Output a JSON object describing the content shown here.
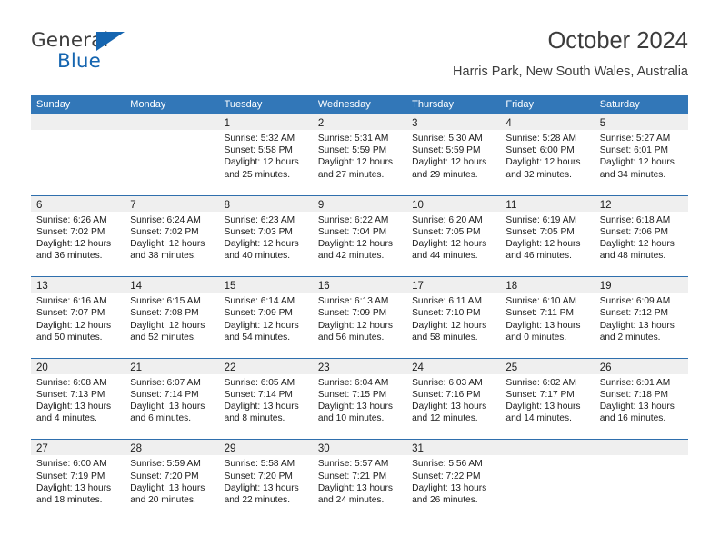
{
  "logo": {
    "word1": "General",
    "word2": "Blue",
    "triangle_color": "#1565b0"
  },
  "header": {
    "title": "October 2024",
    "location": "Harris Park, New South Wales, Australia"
  },
  "theme": {
    "header_blue": "#3277b8",
    "row_rule_blue": "#2f6fad",
    "date_band_gray": "#efefef"
  },
  "weekday_headers": [
    "Sunday",
    "Monday",
    "Tuesday",
    "Wednesday",
    "Thursday",
    "Friday",
    "Saturday"
  ],
  "weeks": [
    [
      {
        "day": "",
        "sunrise": "",
        "sunset": "",
        "daylight1": "",
        "daylight2": ""
      },
      {
        "day": "",
        "sunrise": "",
        "sunset": "",
        "daylight1": "",
        "daylight2": ""
      },
      {
        "day": "1",
        "sunrise": "Sunrise: 5:32 AM",
        "sunset": "Sunset: 5:58 PM",
        "daylight1": "Daylight: 12 hours",
        "daylight2": "and 25 minutes."
      },
      {
        "day": "2",
        "sunrise": "Sunrise: 5:31 AM",
        "sunset": "Sunset: 5:59 PM",
        "daylight1": "Daylight: 12 hours",
        "daylight2": "and 27 minutes."
      },
      {
        "day": "3",
        "sunrise": "Sunrise: 5:30 AM",
        "sunset": "Sunset: 5:59 PM",
        "daylight1": "Daylight: 12 hours",
        "daylight2": "and 29 minutes."
      },
      {
        "day": "4",
        "sunrise": "Sunrise: 5:28 AM",
        "sunset": "Sunset: 6:00 PM",
        "daylight1": "Daylight: 12 hours",
        "daylight2": "and 32 minutes."
      },
      {
        "day": "5",
        "sunrise": "Sunrise: 5:27 AM",
        "sunset": "Sunset: 6:01 PM",
        "daylight1": "Daylight: 12 hours",
        "daylight2": "and 34 minutes."
      }
    ],
    [
      {
        "day": "6",
        "sunrise": "Sunrise: 6:26 AM",
        "sunset": "Sunset: 7:02 PM",
        "daylight1": "Daylight: 12 hours",
        "daylight2": "and 36 minutes."
      },
      {
        "day": "7",
        "sunrise": "Sunrise: 6:24 AM",
        "sunset": "Sunset: 7:02 PM",
        "daylight1": "Daylight: 12 hours",
        "daylight2": "and 38 minutes."
      },
      {
        "day": "8",
        "sunrise": "Sunrise: 6:23 AM",
        "sunset": "Sunset: 7:03 PM",
        "daylight1": "Daylight: 12 hours",
        "daylight2": "and 40 minutes."
      },
      {
        "day": "9",
        "sunrise": "Sunrise: 6:22 AM",
        "sunset": "Sunset: 7:04 PM",
        "daylight1": "Daylight: 12 hours",
        "daylight2": "and 42 minutes."
      },
      {
        "day": "10",
        "sunrise": "Sunrise: 6:20 AM",
        "sunset": "Sunset: 7:05 PM",
        "daylight1": "Daylight: 12 hours",
        "daylight2": "and 44 minutes."
      },
      {
        "day": "11",
        "sunrise": "Sunrise: 6:19 AM",
        "sunset": "Sunset: 7:05 PM",
        "daylight1": "Daylight: 12 hours",
        "daylight2": "and 46 minutes."
      },
      {
        "day": "12",
        "sunrise": "Sunrise: 6:18 AM",
        "sunset": "Sunset: 7:06 PM",
        "daylight1": "Daylight: 12 hours",
        "daylight2": "and 48 minutes."
      }
    ],
    [
      {
        "day": "13",
        "sunrise": "Sunrise: 6:16 AM",
        "sunset": "Sunset: 7:07 PM",
        "daylight1": "Daylight: 12 hours",
        "daylight2": "and 50 minutes."
      },
      {
        "day": "14",
        "sunrise": "Sunrise: 6:15 AM",
        "sunset": "Sunset: 7:08 PM",
        "daylight1": "Daylight: 12 hours",
        "daylight2": "and 52 minutes."
      },
      {
        "day": "15",
        "sunrise": "Sunrise: 6:14 AM",
        "sunset": "Sunset: 7:09 PM",
        "daylight1": "Daylight: 12 hours",
        "daylight2": "and 54 minutes."
      },
      {
        "day": "16",
        "sunrise": "Sunrise: 6:13 AM",
        "sunset": "Sunset: 7:09 PM",
        "daylight1": "Daylight: 12 hours",
        "daylight2": "and 56 minutes."
      },
      {
        "day": "17",
        "sunrise": "Sunrise: 6:11 AM",
        "sunset": "Sunset: 7:10 PM",
        "daylight1": "Daylight: 12 hours",
        "daylight2": "and 58 minutes."
      },
      {
        "day": "18",
        "sunrise": "Sunrise: 6:10 AM",
        "sunset": "Sunset: 7:11 PM",
        "daylight1": "Daylight: 13 hours",
        "daylight2": "and 0 minutes."
      },
      {
        "day": "19",
        "sunrise": "Sunrise: 6:09 AM",
        "sunset": "Sunset: 7:12 PM",
        "daylight1": "Daylight: 13 hours",
        "daylight2": "and 2 minutes."
      }
    ],
    [
      {
        "day": "20",
        "sunrise": "Sunrise: 6:08 AM",
        "sunset": "Sunset: 7:13 PM",
        "daylight1": "Daylight: 13 hours",
        "daylight2": "and 4 minutes."
      },
      {
        "day": "21",
        "sunrise": "Sunrise: 6:07 AM",
        "sunset": "Sunset: 7:14 PM",
        "daylight1": "Daylight: 13 hours",
        "daylight2": "and 6 minutes."
      },
      {
        "day": "22",
        "sunrise": "Sunrise: 6:05 AM",
        "sunset": "Sunset: 7:14 PM",
        "daylight1": "Daylight: 13 hours",
        "daylight2": "and 8 minutes."
      },
      {
        "day": "23",
        "sunrise": "Sunrise: 6:04 AM",
        "sunset": "Sunset: 7:15 PM",
        "daylight1": "Daylight: 13 hours",
        "daylight2": "and 10 minutes."
      },
      {
        "day": "24",
        "sunrise": "Sunrise: 6:03 AM",
        "sunset": "Sunset: 7:16 PM",
        "daylight1": "Daylight: 13 hours",
        "daylight2": "and 12 minutes."
      },
      {
        "day": "25",
        "sunrise": "Sunrise: 6:02 AM",
        "sunset": "Sunset: 7:17 PM",
        "daylight1": "Daylight: 13 hours",
        "daylight2": "and 14 minutes."
      },
      {
        "day": "26",
        "sunrise": "Sunrise: 6:01 AM",
        "sunset": "Sunset: 7:18 PM",
        "daylight1": "Daylight: 13 hours",
        "daylight2": "and 16 minutes."
      }
    ],
    [
      {
        "day": "27",
        "sunrise": "Sunrise: 6:00 AM",
        "sunset": "Sunset: 7:19 PM",
        "daylight1": "Daylight: 13 hours",
        "daylight2": "and 18 minutes."
      },
      {
        "day": "28",
        "sunrise": "Sunrise: 5:59 AM",
        "sunset": "Sunset: 7:20 PM",
        "daylight1": "Daylight: 13 hours",
        "daylight2": "and 20 minutes."
      },
      {
        "day": "29",
        "sunrise": "Sunrise: 5:58 AM",
        "sunset": "Sunset: 7:20 PM",
        "daylight1": "Daylight: 13 hours",
        "daylight2": "and 22 minutes."
      },
      {
        "day": "30",
        "sunrise": "Sunrise: 5:57 AM",
        "sunset": "Sunset: 7:21 PM",
        "daylight1": "Daylight: 13 hours",
        "daylight2": "and 24 minutes."
      },
      {
        "day": "31",
        "sunrise": "Sunrise: 5:56 AM",
        "sunset": "Sunset: 7:22 PM",
        "daylight1": "Daylight: 13 hours",
        "daylight2": "and 26 minutes."
      },
      {
        "day": "",
        "sunrise": "",
        "sunset": "",
        "daylight1": "",
        "daylight2": ""
      },
      {
        "day": "",
        "sunrise": "",
        "sunset": "",
        "daylight1": "",
        "daylight2": ""
      }
    ]
  ]
}
